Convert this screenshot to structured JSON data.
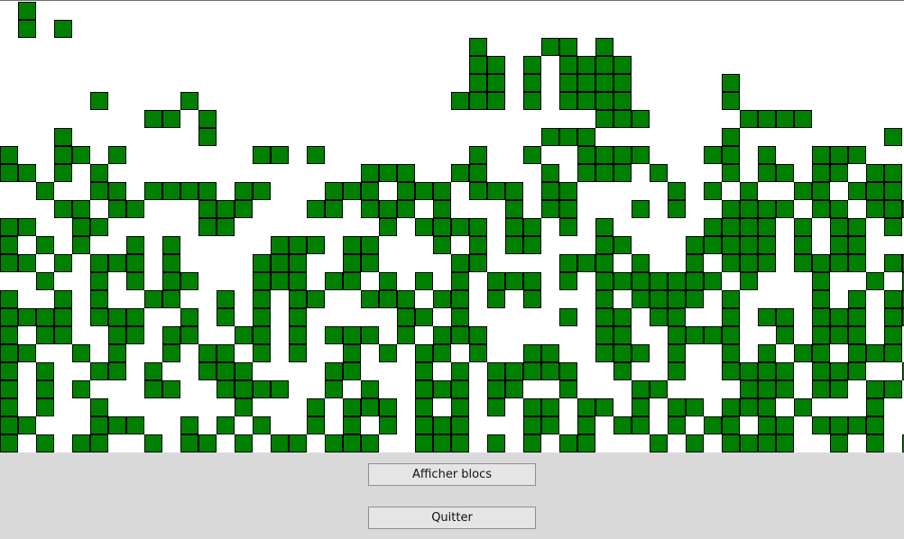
{
  "colors": {
    "block_fill": "#008000",
    "block_border": "#000000",
    "canvas_bg": "#ffffff"
  },
  "grid": {
    "rows": [
      ".#..........................................................",
      ".#.#........................................................",
      "..........................#...##.#..........................",
      "..........................##.#.####.........................",
      "..........................##.#.####.....#...................",
      ".....#....#..............###.#.####.....#...................",
      "........##.#.....................###.....####...............",
      "...#.......#..................###.......#........#...#.......",
      "#..##.#.......##.#........#..#..####...##.#..###............",
      "##.#.#..............###..##...#.###.#...#.##.##.##.#........",
      "..#..##.####.##...###.###.###.##.....#.#.#..##.###.##.......",
      "...##.##...###...##.###.#...#.##...#.#..####.##.####........",
      "##..##.....##........#.####.##.#.#.....####.#.##.#..#.......",
      "#.#.#..#.#.....###.##...#.#.##...##...#####.#.##...#........",
      "##.#.###.#....###..##....##....###.#..#.###.####.##.##......",
      "..#..#.#.##...###.##.#.#.#.###.#.#######.#...#..#.##........",
      "#..#.#..##..#.#.##..###.##.#.#...#.####.#....#.#.##.........",
      "####.###..#.#.#.#.....##.#.....#.##.##..#.##.###.##.........",
      "#.##..##.##..##.#.###.#.###......##..####..#.###.#.##.......",
      "##..#.#..#.##.#.#..#.#.##.#..##..###.#..#.#.##.###..........",
      "#.#..##.#..###....##...#.#.#####..#..#..####.###..##........",
      "#.#.#...##..####..#.#..###.##..#...##....###.##.##.#........",
      "#.#..#.......#...#.###.#.#.#.##.##.#.##.###.#...#..#........",
      "##...###..#.#.#..#.#.#.###...##.#.##.#.##.##.####...........",
      "#.#.##..#.##.#.##.###..###.#.#.##...#.#.####..#.#.##........"
    ]
  },
  "buttons": {
    "show_blocks_label": "Afficher blocs",
    "quit_label": "Quitter"
  }
}
